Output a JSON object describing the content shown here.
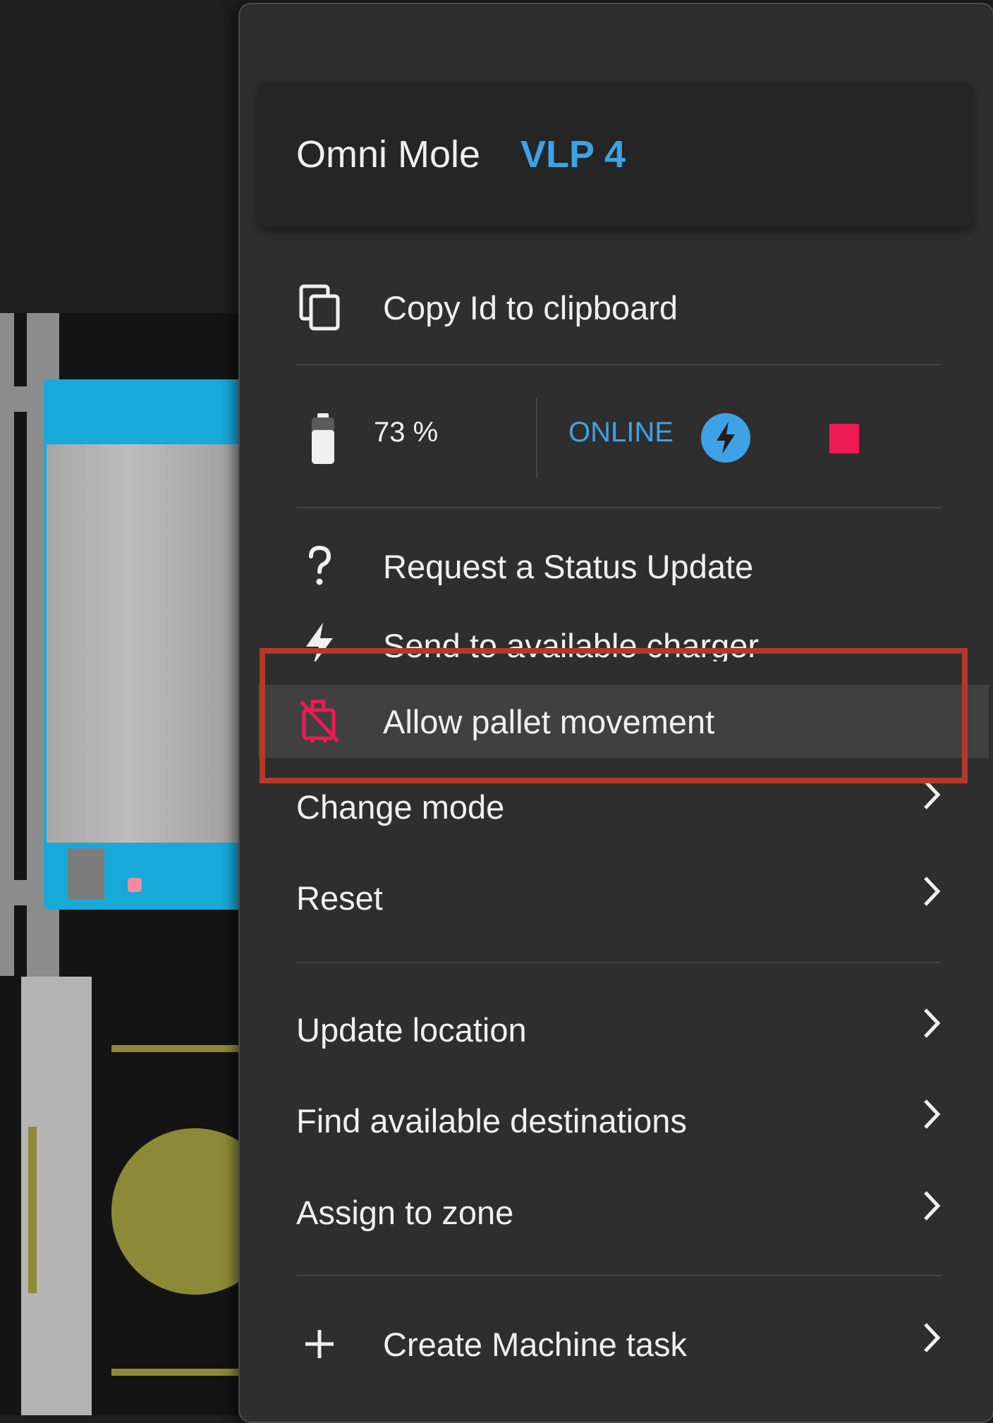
{
  "header": {
    "name": "Omni Mole",
    "id": "VLP 4"
  },
  "copy_id": {
    "label": "Copy Id to clipboard",
    "icon": "copy-icon"
  },
  "status": {
    "battery_percent": "73 %",
    "battery_level": 0.73,
    "connection": "ONLINE",
    "charging_icon": "lightning-icon",
    "indicator_color": "#ee1b55"
  },
  "actions": [
    {
      "label": "Request a Status Update",
      "icon": "question-icon"
    },
    {
      "label": "Send to available charger",
      "icon": "lightning-icon"
    },
    {
      "label": "Allow pallet movement",
      "icon": "pallet-blocked-icon",
      "highlighted": true
    }
  ],
  "submenus_group1": [
    {
      "label": "Change mode"
    },
    {
      "label": "Reset"
    }
  ],
  "submenus_group2": [
    {
      "label": "Update location"
    },
    {
      "label": "Find available destinations"
    },
    {
      "label": "Assign to zone"
    }
  ],
  "create_task": {
    "label": "Create Machine task",
    "icon": "plus-icon"
  },
  "colors": {
    "accent_blue": "#3ea3e6",
    "alert_pink": "#ee1b55",
    "menu_bg": "#2e2e2e",
    "highlight_bg": "#404040",
    "annotation_red": "#b23a2a"
  }
}
